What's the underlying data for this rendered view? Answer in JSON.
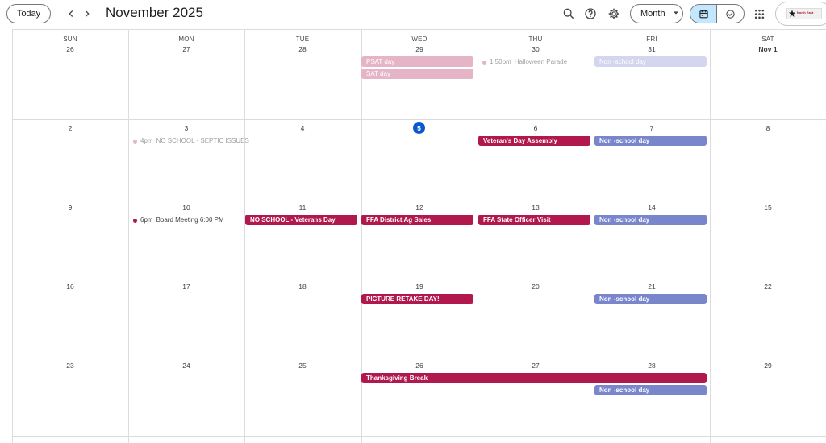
{
  "header": {
    "today_label": "Today",
    "title": "November 2025",
    "view_label": "Month",
    "prev_icon": "chevron-left-icon",
    "next_icon": "chevron-right-icon",
    "search_icon": "search-icon",
    "help_icon": "help-icon",
    "settings_icon": "gear-icon",
    "apps_icon": "apps-grid-icon",
    "calendar_view_icon": "calendar-icon",
    "tasks_view_icon": "task-check-icon",
    "logo_text": "North East"
  },
  "colors": {
    "crimson": "#b1194e",
    "periwinkle": "#7986cb",
    "pale_pink": "#e6b4c7",
    "pale_blue": "#d3d6ee",
    "today_blue": "#0b57d0"
  },
  "days_of_week": [
    "SUN",
    "MON",
    "TUE",
    "WED",
    "THU",
    "FRI",
    "SAT"
  ],
  "weeks": [
    [
      "26",
      "27",
      "28",
      "29",
      "30",
      "31",
      "Nov 1"
    ],
    [
      "2",
      "3",
      "4",
      "5",
      "6",
      "7",
      "8"
    ],
    [
      "9",
      "10",
      "11",
      "12",
      "13",
      "14",
      "15"
    ],
    [
      "16",
      "17",
      "18",
      "19",
      "20",
      "21",
      "22"
    ],
    [
      "23",
      "24",
      "25",
      "26",
      "27",
      "28",
      "29"
    ]
  ],
  "today": "5",
  "events": {
    "psat_day": "PSAT day",
    "sat_day": "SAT day",
    "halloween_time": "1:50pm",
    "halloween_title": "Halloween Parade",
    "non_school_oct31": "Non -school day",
    "no_school_septic_time": "4pm",
    "no_school_septic_title": "NO SCHOOL - SEPTIC ISSUES",
    "veterans_assembly": "Veteran's Day Assembly",
    "non_school_nov7": "Non -school day",
    "board_meeting_time": "6pm",
    "board_meeting_title": "Board Meeting 6:00 PM",
    "no_school_veterans": "NO SCHOOL - Veterans Day",
    "ffa_ag_sales": "FFA District Ag Sales",
    "ffa_state_visit": "FFA State Officer Visit",
    "non_school_nov14": "Non -school day",
    "picture_retake": "PICTURE RETAKE DAY!",
    "non_school_nov21": "Non -school day",
    "thanksgiving_break": "Thanksgiving Break",
    "non_school_nov28": "Non -school day"
  }
}
